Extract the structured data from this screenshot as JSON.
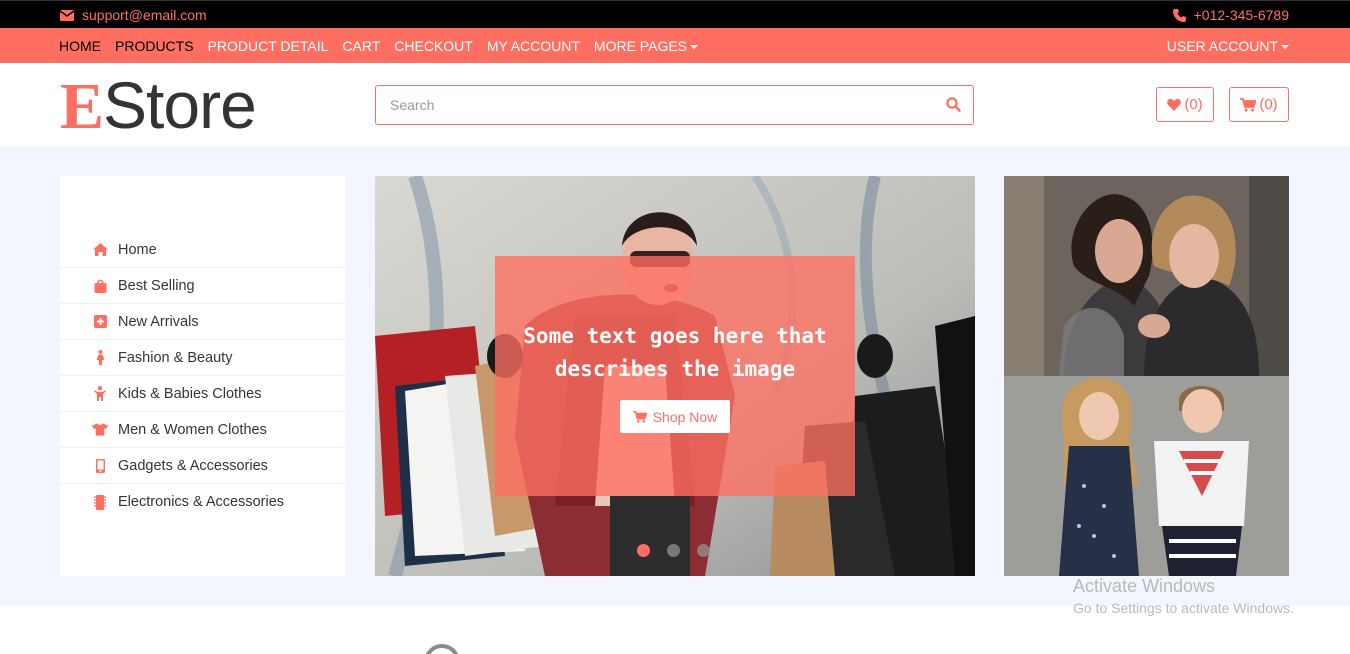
{
  "topbar": {
    "email": "support@email.com",
    "phone": "+012-345-6789"
  },
  "nav": {
    "items": [
      "HOME",
      "PRODUCTS",
      "PRODUCT DETAIL",
      "CART",
      "CHECKOUT",
      "MY ACCOUNT",
      "MORE PAGES"
    ],
    "user_account": "USER ACCOUNT"
  },
  "header": {
    "logo_first": "E",
    "logo_rest": "Store",
    "search_placeholder": "Search",
    "wishlist_count": "(0)",
    "cart_count": "(0)"
  },
  "sidebar": {
    "items": [
      {
        "label": "Home",
        "icon": "home-icon"
      },
      {
        "label": "Best Selling",
        "icon": "shopping-bag-icon"
      },
      {
        "label": "New Arrivals",
        "icon": "plus-square-icon"
      },
      {
        "label": "Fashion & Beauty",
        "icon": "female-icon"
      },
      {
        "label": "Kids & Babies Clothes",
        "icon": "child-icon"
      },
      {
        "label": "Men & Women Clothes",
        "icon": "tshirt-icon"
      },
      {
        "label": "Gadgets & Accessories",
        "icon": "mobile-icon"
      },
      {
        "label": "Electronics & Accessories",
        "icon": "microchip-icon"
      }
    ]
  },
  "slider": {
    "caption_line1": "Some text goes here that",
    "caption_line2": "describes the image",
    "button": "Shop Now",
    "dot_count": 3,
    "active_dot": 1
  },
  "watermark": {
    "line1": "Activate Windows",
    "line2": "Go to Settings to activate Windows."
  },
  "colors": {
    "accent": "#ff6f61",
    "topbar": "#000000",
    "main_bg": "#f3f6ff"
  }
}
